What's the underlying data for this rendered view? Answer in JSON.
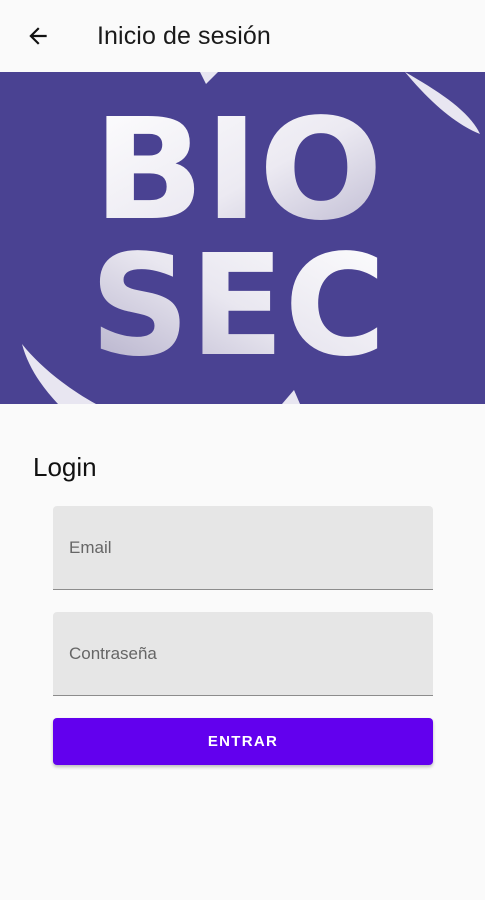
{
  "appbar": {
    "back_icon": "arrow-left-icon",
    "title": "Inicio de sesión"
  },
  "banner": {
    "background_color": "#4a4292",
    "logo_line1": "BIO",
    "logo_line2": "SEC"
  },
  "login": {
    "heading": "Login",
    "email_placeholder": "Email",
    "email_value": "",
    "password_placeholder": "Contraseña",
    "password_value": "",
    "submit_label": "ENTRAR"
  },
  "colors": {
    "accent": "#6200ee",
    "field_bg": "#e6e6e6"
  }
}
